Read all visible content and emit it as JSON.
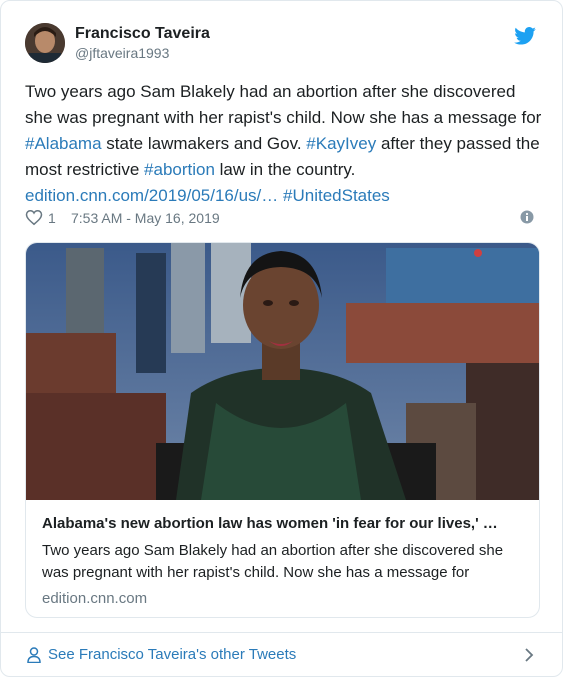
{
  "colors": {
    "link": "#2b7bb9",
    "muted": "#697882",
    "text": "#1c2022",
    "border": "#e1e8ed"
  },
  "header": {
    "avatar_icon": "avatar",
    "name": "Francisco Taveira",
    "handle": "@jftaveira1993",
    "logo_icon": "twitter-bird-icon"
  },
  "tweet": {
    "t1": "Two years ago Sam Blakely had an abortion after she discovered she was pregnant with her rapist's child. Now she has a message for ",
    "h_alabama": "#Alabama",
    "t2": " state lawmakers and Gov. ",
    "h_kayivey": "#KayIvey",
    "t3": " after they passed the most restrictive ",
    "h_abortion": "#abortion",
    "t4": " law in the country. ",
    "url": "edition.cnn.com/2019/05/16/us/…",
    "t5": " ",
    "h_unitedstates": "#UnitedStates"
  },
  "meta": {
    "heart_icon": "heart-icon",
    "likes": "1",
    "timestamp": "7:53 AM - May 16, 2019",
    "info_icon": "info-icon"
  },
  "card": {
    "title": "Alabama's new abortion law has women 'in fear for our lives,' …",
    "description": "Two years ago Sam Blakely had an abortion after she discovered she was pregnant with her rapist's child. Now she has a message for",
    "domain": "edition.cnn.com"
  },
  "footer": {
    "person_icon": "person-icon",
    "label": "See Francisco Taveira's other Tweets",
    "chevron_icon": "chevron-right-icon"
  }
}
